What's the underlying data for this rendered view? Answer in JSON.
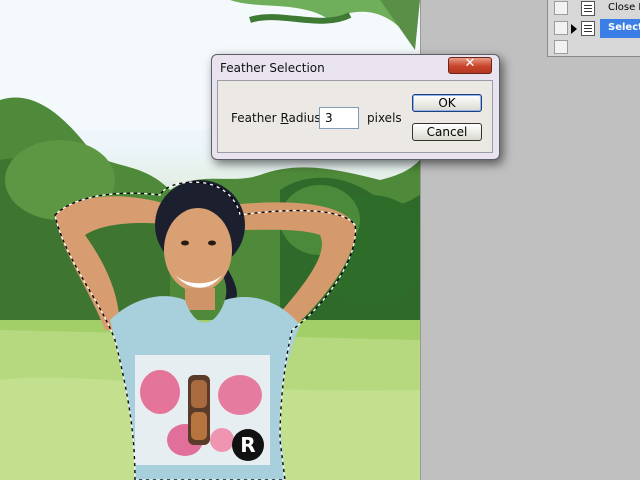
{
  "dialog": {
    "title": "Feather Selection",
    "close_label": "✕",
    "radius_label_prefix": "Feather ",
    "radius_label_accel": "R",
    "radius_label_suffix": "adius:",
    "radius_value": "3",
    "units_label": "pixels",
    "ok_label": "OK",
    "cancel_label": "Cancel"
  },
  "actions_panel": {
    "items": [
      {
        "label": "Close P",
        "selected": false
      },
      {
        "label": "Selection",
        "selected": true
      }
    ]
  },
  "colors": {
    "selection_highlight": "#3a7ee6",
    "dialog_frame": "#e8e3ee",
    "close_button": "#c8442b"
  }
}
